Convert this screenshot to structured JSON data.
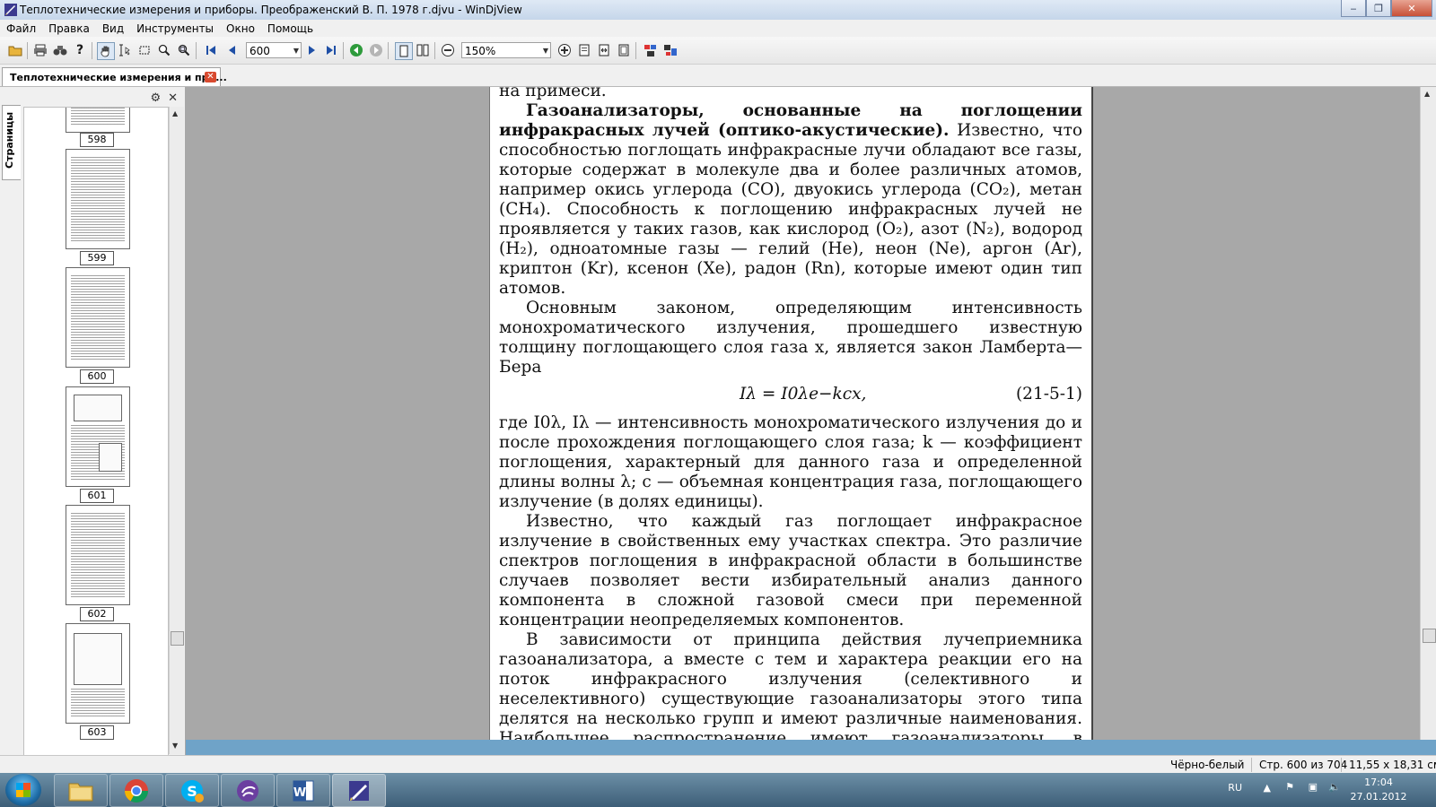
{
  "window": {
    "title": "Теплотехнические измерения и приборы. Преображенский В. П. 1978 г.djvu - WinDjView",
    "buttons": {
      "minimize": "‒",
      "maximize": "❐",
      "close": "✕"
    }
  },
  "menu": [
    "Файл",
    "Правка",
    "Вид",
    "Инструменты",
    "Окно",
    "Помощь"
  ],
  "toolbar": {
    "page_value": "600",
    "zoom_value": "150%"
  },
  "tab": {
    "label": "Теплотехнические измерения и при...",
    "close": "✕"
  },
  "sidebar": {
    "tab_label": "Страницы",
    "thumbnails": [
      "598",
      "599",
      "600",
      "601",
      "602",
      "603"
    ]
  },
  "document": {
    "p0": "на примеси.",
    "p1_bold": "Газоанализаторы, основанные на поглощении инфракрасных лучей (оптико-акустические).",
    "p1_rest": " Известно, что способностью поглощать инфракрасные лучи обладают все газы, которые содержат в молекуле два и более различных атомов, например окись углерода (CO), двуокись углерода (CO₂), метан (CH₄). Способность к поглощению инфракрасных лучей не проявляется у таких газов, как кислород (O₂), азот (N₂), водород (H₂), одноатомные газы — гелий (He), неон (Ne), аргон (Ar), криптон (Kr), ксенон (Xe), радон (Rn), которые имеют один тип атомов.",
    "p2": "Основным законом, определяющим интенсивность монохроматического излучения, прошедшего известную толщину поглощающего слоя газа x, является закон Ламберта—Бера",
    "formula": "Iλ = I0λe−kcx,",
    "equation_number": "(21-5-1)",
    "p3": "где I0λ, Iλ — интенсивность монохроматического излучения до и после прохождения поглощающего слоя газа; k — коэффициент поглощения, характерный для данного газа и определенной длины волны λ; c — объемная концентрация газа, поглощающего излучение (в долях единицы).",
    "p4": "Известно, что каждый газ поглощает инфракрасное излучение в свойственных ему участках спектра. Это различие спектров поглощения в инфракрасной области в большинстве случаев позволяет вести избирательный анализ данного компонента в сложной газовой смеси при переменной концентрации неопределяемых компонентов.",
    "p5": "В зависимости от принципа действия лучеприемника газоанализатора, а вместе с тем и характера реакции его на поток инфракрасного излучения (селективного и неселективного) существующие газоанализаторы этого типа делятся на несколько групп и имеют различные наименования. Наибольшее распространение имеют газоанализаторы, в которых используется селективный оптико-акустический лучеприемник."
  },
  "status": {
    "mode": "Чёрно-белый",
    "page_info": "Стр. 600 из 704",
    "page_size": "11,55 x 18,31 см"
  },
  "taskbar": {
    "lang": "RU",
    "time": "17:04",
    "date": "27.01.2012"
  }
}
